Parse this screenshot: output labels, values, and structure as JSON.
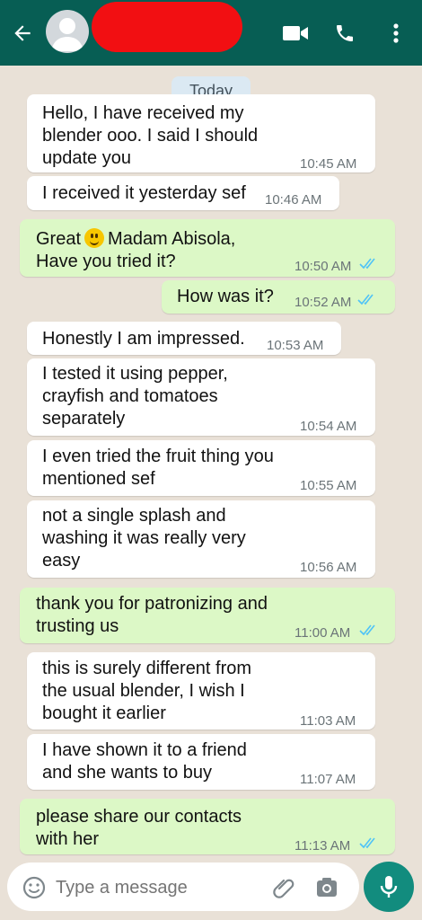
{
  "header": {
    "back_icon": "back-arrow-icon",
    "avatar_icon": "default-avatar-icon"
  },
  "date_chip": "Today",
  "messages": [
    {
      "dir": "in",
      "lines": [
        "Hello, I have received my",
        "blender ooo. I said I should",
        "update you"
      ],
      "time": "10:45 AM"
    },
    {
      "dir": "in",
      "lines": [
        "I received it yesterday sef"
      ],
      "time": "10:46 AM"
    },
    {
      "dir": "out",
      "lines": [
        "Great",
        "Madam Abisola,",
        "Have you tried it?"
      ],
      "time": "10:50 AM"
    },
    {
      "dir": "out",
      "lines": [
        "How was it?"
      ],
      "time": "10:52 AM"
    },
    {
      "dir": "in",
      "lines": [
        "Honestly I am impressed."
      ],
      "time": "10:53 AM"
    },
    {
      "dir": "in",
      "lines": [
        "I tested it using pepper,",
        "crayfish and tomatoes",
        "separately"
      ],
      "time": "10:54 AM"
    },
    {
      "dir": "in",
      "lines": [
        "I even tried the fruit thing you",
        "mentioned sef"
      ],
      "time": "10:55 AM"
    },
    {
      "dir": "in",
      "lines": [
        "not a single splash and",
        "washing it was really very",
        "easy"
      ],
      "time": "10:56 AM"
    },
    {
      "dir": "out",
      "lines": [
        "thank you for patronizing and",
        "trusting us"
      ],
      "time": "11:00 AM"
    },
    {
      "dir": "in",
      "lines": [
        "this is surely different from",
        "the usual blender, I wish I",
        "bought it earlier"
      ],
      "time": "11:03 AM"
    },
    {
      "dir": "in",
      "lines": [
        "I have shown it to a friend",
        "and she wants to buy"
      ],
      "time": "11:07 AM"
    },
    {
      "dir": "out",
      "lines": [
        "please share our contacts",
        "with her"
      ],
      "time": "11:13 AM"
    }
  ],
  "composer": {
    "placeholder": "Type a message"
  },
  "colors": {
    "header": "#075e54",
    "outgoing": "#dcf8c6",
    "incoming": "#ffffff",
    "read_ticks": "#4fc3f7",
    "mic": "#128c7e"
  }
}
